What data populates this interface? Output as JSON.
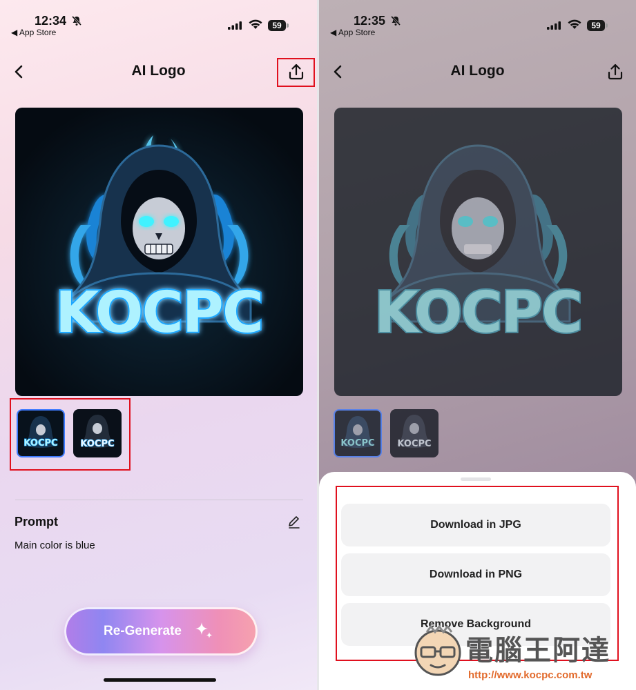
{
  "left": {
    "status": {
      "time": "12:34",
      "back_app": "◀ App Store",
      "battery": "59"
    },
    "nav": {
      "title": "AI Logo"
    },
    "logo": {
      "text": "KOCPC"
    },
    "thumbs": [
      {
        "text": "KOCPC",
        "selected": true
      },
      {
        "text": "KOCPC",
        "selected": false
      }
    ],
    "prompt": {
      "label": "Prompt",
      "text": "Main color is blue"
    },
    "regenerate_label": "Re-Generate"
  },
  "right": {
    "status": {
      "time": "12:35",
      "back_app": "◀ App Store",
      "battery": "59"
    },
    "nav": {
      "title": "AI Logo"
    },
    "logo": {
      "text": "KOCPC"
    },
    "thumbs": [
      {
        "text": "KOCPC",
        "selected": true
      },
      {
        "text": "KOCPC",
        "selected": false
      }
    ],
    "sheet": {
      "buttons": [
        "Download in JPG",
        "Download in PNG",
        "Remove Background"
      ]
    }
  },
  "watermark": {
    "text": "電腦王阿達",
    "url": "http://www.kocpc.com.tw"
  },
  "colors": {
    "highlight": "#e0101e",
    "accent": "#3e7bff",
    "logo_glow": "#39c8ff"
  },
  "icons": {
    "back": "chevron-left-icon",
    "share": "share-icon",
    "edit": "pencil-icon",
    "sparkle": "sparkle-icon"
  }
}
